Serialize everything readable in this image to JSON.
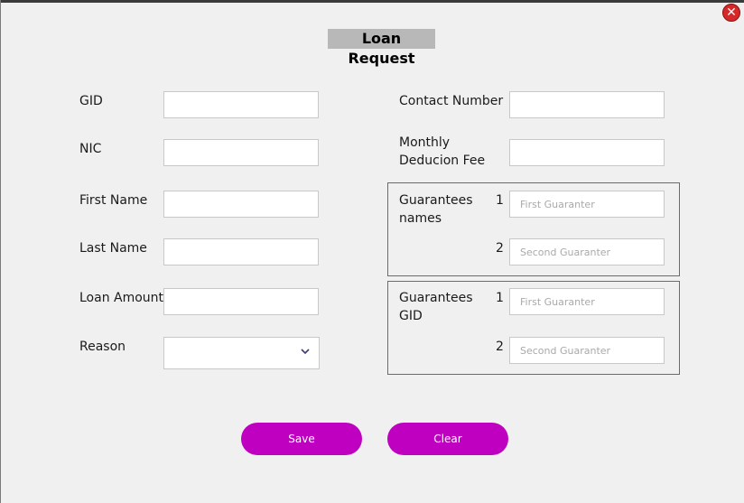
{
  "window": {
    "title": "Loan Request",
    "close_glyph": "✕",
    "close_color": "#d62828"
  },
  "left": {
    "gid_label": "GID",
    "nic_label": "NIC",
    "first_name_label": "First Name",
    "last_name_label": "Last Name",
    "loan_amount_label": "Loan Amount",
    "reason_label": "Reason",
    "reason_value": ""
  },
  "right": {
    "contact_number_label": "Contact Number",
    "monthly_line1": "Monthly",
    "monthly_line2": "Deducion Fee",
    "guarantees_names": {
      "label_line1": "Guarantees",
      "label_line2": "names",
      "num1": "1",
      "num2": "2",
      "placeholder1": "First Guaranter",
      "placeholder2": "Second Guaranter"
    },
    "guarantees_gid": {
      "label_line1": "Guarantees",
      "label_line2": "GID",
      "num1": "1",
      "num2": "2",
      "placeholder1": "First Guaranter",
      "placeholder2": "Second Guaranter"
    }
  },
  "buttons": {
    "save": "Save",
    "clear": "Clear",
    "accent": "#c000c0"
  }
}
